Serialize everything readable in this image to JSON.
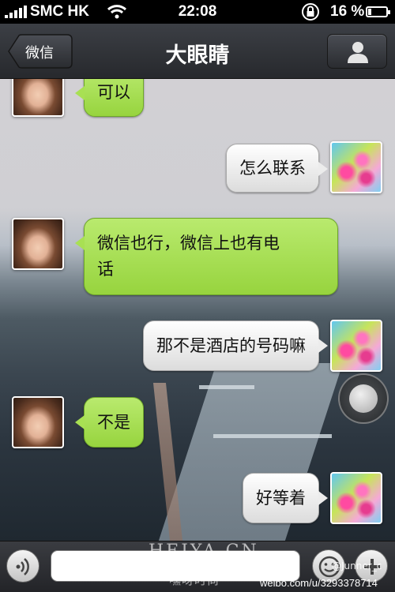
{
  "status_bar": {
    "carrier": "SMC HK",
    "time": "22:08",
    "battery": "16 %",
    "battery_level": 0.16
  },
  "nav": {
    "back_label": "微信",
    "title": "大眼睛"
  },
  "messages": [
    {
      "side": "left",
      "text_lines": [
        "可以"
      ]
    },
    {
      "side": "right",
      "text_lines": [
        "怎么联系"
      ]
    },
    {
      "side": "left",
      "text_lines": [
        "微信也行，微信上也有电",
        "话"
      ]
    },
    {
      "side": "right",
      "text_lines": [
        "那不是酒店的号码嘛"
      ]
    },
    {
      "side": "left",
      "text_lines": [
        "不是"
      ]
    },
    {
      "side": "right",
      "text_lines": [
        "好等着"
      ]
    }
  ],
  "watermarks": {
    "heiya": "HEIYA.CN",
    "heiya_cn": "嘿呀时尚",
    "user": "@Junner_c",
    "weibo": "weibo.com/u/3293378714"
  },
  "colors": {
    "incoming_bubble": "#a8e053",
    "outgoing_bubble": "#ececec",
    "bar": "#2b2d31"
  }
}
